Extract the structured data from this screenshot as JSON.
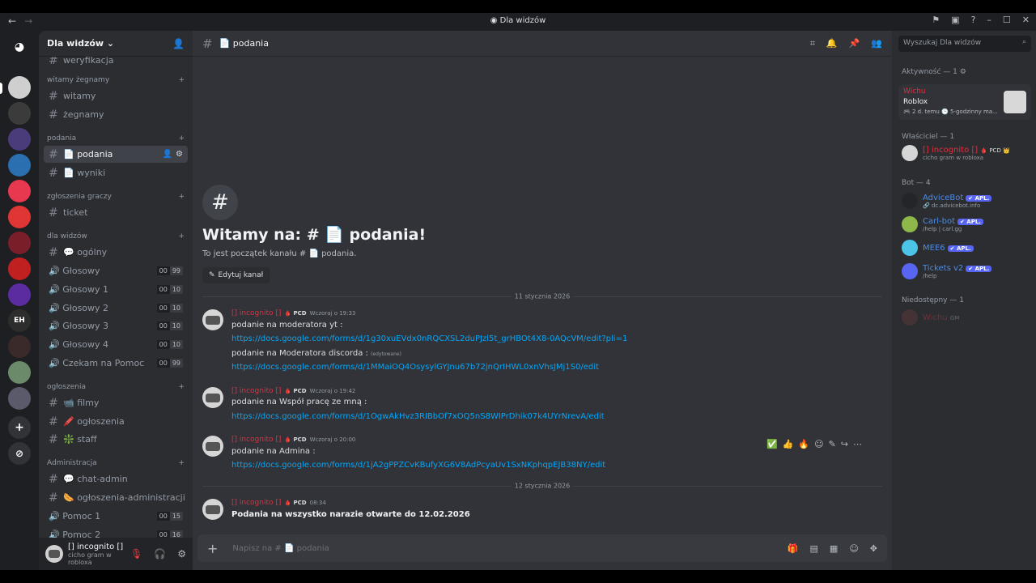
{
  "window": {
    "title": "Dla widzów",
    "back": "←",
    "forward": "→"
  },
  "server": {
    "name": "Dla widzów ⌄"
  },
  "channels": {
    "partial_top": "weryfikacja",
    "categories": [
      {
        "label": "witamy żegnamy",
        "channels": [
          "witamy",
          "żegnamy"
        ]
      },
      {
        "label": "podania",
        "channels": [
          "📄 podania",
          "📄 wyniki"
        ]
      },
      {
        "label": "zgłoszenia graczy",
        "channels": [
          "ticket"
        ]
      },
      {
        "label": "dla widzów",
        "channels": [
          "💬 ogólny",
          "🔊 Głosowy",
          "🔊 Głosowy 1",
          "🔊 Głosowy 2",
          "🔊 Głosowy 3",
          "🔊 Głosowy 4",
          "🔊 Czekam na Pomoc"
        ]
      },
      {
        "label": "ogłoszenia",
        "channels": [
          "📹 filmy",
          "🖍️ ogłoszenia",
          "❇️ staff"
        ]
      },
      {
        "label": "Administracja",
        "channels": [
          "💬 chat-admin",
          "🌭 ogłoszenia-administracji",
          "🔊 Pomoc 1",
          "🔊 Pomoc 2"
        ]
      }
    ],
    "voice_badges": {
      "glosowy": [
        "00",
        "99"
      ],
      "glosowy1": [
        "00",
        "10"
      ],
      "glosowy2": [
        "00",
        "10"
      ],
      "glosowy3": [
        "00",
        "10"
      ],
      "glosowy4": [
        "00",
        "10"
      ],
      "czekam": [
        "00",
        "99"
      ],
      "pomoc1": [
        "00",
        "15"
      ],
      "pomoc2": [
        "00",
        "16"
      ]
    }
  },
  "user_panel": {
    "name": "[] incognito []",
    "status": "cicho gram w robloxa"
  },
  "chat": {
    "channel": "📄 podania",
    "welcome_title": "Witamy na: # 📄 podania!",
    "welcome_sub": "To jest początek kanału # 📄 podania.",
    "edit_button": "Edytuj kanał",
    "date1": "11 stycznia 2026",
    "date2": "12 stycznia 2026",
    "author": "[] incognito []",
    "tag": "🩸 PCD",
    "messages": [
      {
        "time": "Wczoraj o 19:33",
        "lines": [
          "podanie na moderatora yt :",
          "https://docs.google.com/forms/d/1g30xuEVdx0nRQCXSL2duPJzl5t_grHBOt4X8-0AQcVM/edit?pli=1",
          "podanie na Moderatora discorda :",
          "https://docs.google.com/forms/d/1MMaiOQ4OsysylGYJnu67b72jnQrIHWL0xnVhsJMj1S0/edit"
        ],
        "edited": "(edytowane)"
      },
      {
        "time": "Wczoraj o 19:42",
        "lines": [
          "podanie na Współ pracę ze mną :",
          "https://docs.google.com/forms/d/1OgwAkHvz3RIBbOf7xOQ5nS8WIPrDhik07k4UYrNrevA/edit"
        ]
      },
      {
        "time": "Wczoraj o 20:00",
        "lines": [
          "podanie na Admina :",
          "https://docs.google.com/forms/d/1jA2gPPZCvKBufyXG6V8AdPcyaUv1SxNKphqpEJB38NY/edit"
        ]
      },
      {
        "time": "08:34",
        "lines": [
          "Podania na wszystko narazie otwarte do 12.02.2026"
        ]
      }
    ],
    "composer_placeholder": "Napisz na # 📄 podania"
  },
  "members": {
    "search_placeholder": "Wyszukaj Dla widzów",
    "activity_header": "Aktywność — 1 ⚙",
    "activity": {
      "user": "Wichu",
      "game": "Roblox",
      "meta": "🎮 2 d. temu  🕒 5-godzinny ma..."
    },
    "owner_header": "Właściciel — 1",
    "owner": {
      "name": "[] incognito []",
      "tag": "🩸 PCD 👑",
      "status": "cicho gram w robloxa"
    },
    "bot_header": "Bot — 4",
    "bots": [
      {
        "name": "AdviceBot",
        "badge": "✔ APL.",
        "status": "🔗 dc.advicebot.info",
        "color": "#4d8ce6"
      },
      {
        "name": "Carl-bot",
        "badge": "✔ APL.",
        "status": "/help | carl.gg",
        "color": "#8fb84a"
      },
      {
        "name": "MEE6",
        "badge": "✔ APL.",
        "status": "",
        "color": "#4cc4e8"
      },
      {
        "name": "Tickets v2",
        "badge": "✔ APL.",
        "status": "/help",
        "color": "#5865f2"
      }
    ],
    "offline_header": "Niedostępny — 1",
    "offline": {
      "name": "Wichu",
      "tag": "GM"
    }
  },
  "colors": {
    "accent": "#5865f2",
    "author": "#e0303f",
    "link": "#00a8fc"
  }
}
